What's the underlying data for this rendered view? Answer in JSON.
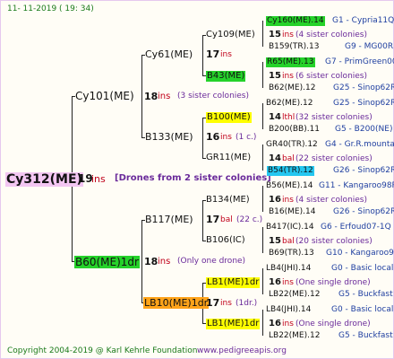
{
  "header": {
    "date": "11- 11-2019 ( 19: 34)"
  },
  "footer": {
    "copyright": "Copyright 2004-2019 @ Karl Kehrle Foundation",
    "site": "www.pedigreeapis.org"
  },
  "colors": {
    "root_bg": "#f3c6f2",
    "green_bg": "#25d22a",
    "yellow_bg": "#ffff00",
    "orange_bg": "#ffa31a",
    "cyan_bg": "#25c7f0",
    "ins_red": "#c0001a",
    "colony_purple": "#6a2a9a",
    "text_blue": "#1f3fa0"
  },
  "root": {
    "name": "Cy312(ME)",
    "ins_num": "19",
    "ins_word": "ins",
    "note": "[Drones from 2 sister colonies]"
  },
  "gen1": {
    "top": {
      "name": "Cy101(ME)",
      "ins_num": "18",
      "ins_word": "ins",
      "note": "(3 sister colonies)"
    },
    "bottom": {
      "name": "B60(ME)1dr",
      "ins_num": "18",
      "ins_word": "ins",
      "note": "(Only one drone)"
    }
  },
  "gen2": {
    "cy61": {
      "name": "Cy61(ME)",
      "ins_num": "17",
      "ins_word": "ins"
    },
    "b133": {
      "name": "B133(ME)",
      "ins_num": "16",
      "ins_word": "ins",
      "note": "(1 c.)"
    },
    "b117": {
      "name": "B117(ME)",
      "ins_num": "17",
      "ins_word": "bal",
      "note": "(22 c.)"
    },
    "lb10": {
      "name": "LB10(ME)1dr",
      "ins_num": "17",
      "ins_word": "ins",
      "note": "(1dr.)"
    }
  },
  "gen3": {
    "cy109": {
      "name": "Cy109(ME)"
    },
    "b43": {
      "name": "B43(ME)"
    },
    "b100": {
      "name": "B100(ME)"
    },
    "gr11": {
      "name": "GR11(ME)"
    },
    "b134": {
      "name": "B134(ME)"
    },
    "b106": {
      "name": "B106(IC)"
    },
    "lb1a": {
      "name": "LB1(ME)1dr"
    },
    "lb1b": {
      "name": "LB1(ME)1dr"
    }
  },
  "gen4": [
    {
      "name": "Cy160(ME).14",
      "breeder": "G1 - Cypria11Q",
      "ins_num": "15",
      "ins_word": "ins",
      "note": "(4 sister colonies)",
      "sub_name": "B159(TR).13",
      "sub_breeder": "G9 - MG00R"
    },
    {
      "name": "R65(ME).13",
      "breeder": "G7 - PrimGreen00",
      "ins_num": "15",
      "ins_word": "ins",
      "note": "(6 sister colonies)",
      "sub_name": "B62(ME).12",
      "sub_breeder": "G25 - Sinop62R"
    },
    {
      "name": "B62(ME).12",
      "breeder": "G25 - Sinop62R",
      "ins_num": "14",
      "ins_word": "lthl",
      "note": "(32 sister colonies)",
      "sub_name": "B200(BB).11",
      "sub_breeder": "G5 - B200(NE)"
    },
    {
      "name": "GR40(TR).12",
      "breeder": "G4 - Gr.R.mounta",
      "ins_num": "14",
      "ins_word": "bal",
      "note": "(22 sister colonies)",
      "sub_name": "B54(TR).12",
      "sub_breeder": "G26 - Sinop62R"
    },
    {
      "name": "B56(ME).14",
      "breeder": "G11 - Kangaroo98R",
      "ins_num": "16",
      "ins_word": "ins",
      "note": "(4 sister colonies)",
      "sub_name": "B16(ME).14",
      "sub_breeder": "G26 - Sinop62R"
    },
    {
      "name": "B417(IC).14",
      "breeder": "G6 - Erfoud07-1Q",
      "ins_num": "15",
      "ins_word": "bal",
      "note": "(20 sister colonies)",
      "sub_name": "B69(TR).13",
      "sub_breeder": "G10 - Kangaroo98R"
    },
    {
      "name": "LB4(JHI).14",
      "breeder": "G0 - Basic local",
      "ins_num": "16",
      "ins_word": "ins",
      "note": "(One single drone)",
      "sub_name": "LB22(ME).12",
      "sub_breeder": "G5 - Buckfast"
    },
    {
      "name": "LB4(JHI).14",
      "breeder": "G0 - Basic local",
      "ins_num": "16",
      "ins_word": "ins",
      "note": "(One single drone)",
      "sub_name": "LB22(ME).12",
      "sub_breeder": "G5 - Buckfast"
    }
  ]
}
